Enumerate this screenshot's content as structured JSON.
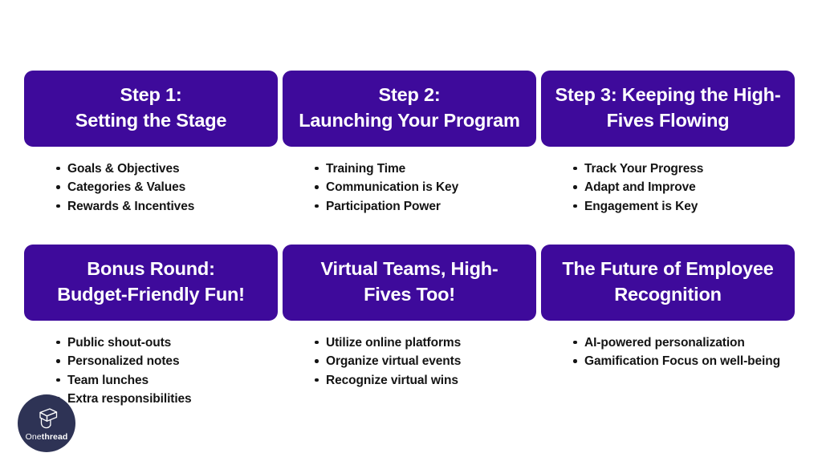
{
  "page": {
    "background_color": "#FFFFFF",
    "card_color": "#3E0A9B",
    "card_title_color": "#FFFFFF",
    "bullet_text_color": "#141414"
  },
  "cards": [
    {
      "title_line_1": "Step 1:",
      "title_line_2": "Setting the Stage",
      "bullets": [
        "Goals & Objectives",
        "Categories & Values",
        "Rewards & Incentives"
      ]
    },
    {
      "title_line_1": "Step 2:",
      "title_line_2": "Launching Your Program",
      "bullets": [
        "Training Time",
        "Communication is Key",
        "Participation Power"
      ]
    },
    {
      "title_line_1": "Step 3: Keeping the High-",
      "title_line_2": "Fives Flowing",
      "bullets": [
        "Track Your Progress",
        "Adapt and Improve",
        "Engagement is Key"
      ]
    },
    {
      "title_line_1": "Bonus Round:",
      "title_line_2": "Budget-Friendly Fun!",
      "bullets": [
        "Public shout-outs",
        "Personalized notes",
        "Team lunches",
        "Extra responsibilities"
      ]
    },
    {
      "title_line_1": "Virtual Teams, High-",
      "title_line_2": "Fives Too!",
      "bullets": [
        "Utilize online platforms",
        "Organize virtual events",
        "Recognize virtual wins"
      ]
    },
    {
      "title_line_1": "The Future of Employee",
      "title_line_2": "Recognition",
      "bullets": [
        "AI-powered personalization",
        "Gamification Focus on well-being"
      ]
    }
  ],
  "logo": {
    "name": "Onethread",
    "name_prefix": "One",
    "name_suffix": "thread",
    "circle_color": "#2E3355",
    "mark_icon": "thread-spool-icon"
  }
}
